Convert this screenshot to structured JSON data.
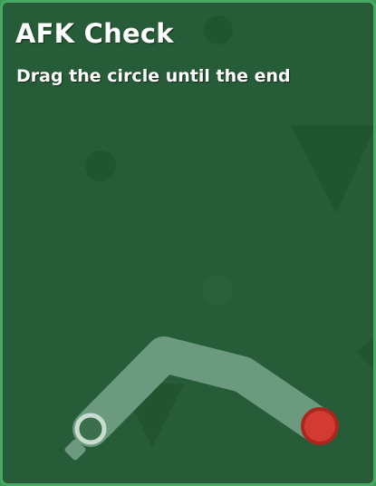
{
  "game": {
    "title": "AFK Check",
    "instruction": "Drag the circle until the end"
  },
  "colors": {
    "panel_background": "#265c37",
    "panel_border": "#4aa865",
    "track": "#6b9a7e",
    "start_ring": "#3a6e4c",
    "start_ring_stroke": "#c9dccf",
    "draggable_circle": "#d33a31",
    "draggable_circle_stroke": "#a82820"
  }
}
